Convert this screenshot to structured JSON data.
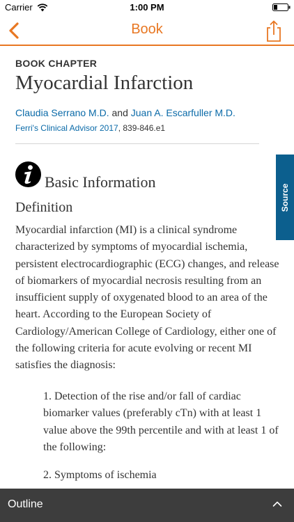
{
  "status_bar": {
    "carrier": "Carrier",
    "time": "1:00 PM",
    "icons": [
      "wifi-icon",
      "battery-icon"
    ]
  },
  "nav": {
    "title": "Book",
    "back_icon": "chevron-left-icon",
    "share_icon": "share-icon",
    "accent_color": "#e87722"
  },
  "chapter": {
    "label": "BOOK CHAPTER",
    "title": "Myocardial Infarction",
    "author_1": "Claudia Serrano M.D.",
    "author_joiner": " and ",
    "author_2": "Juan A. Escarfuller M.D.",
    "source_title": "Ferri's Clinical Advisor 2017",
    "source_pages": ", 839-846.e1",
    "link_color": "#0a6aa8"
  },
  "section": {
    "icon": "info-icon",
    "heading": "Basic Information",
    "subheading": "Definition",
    "paragraph": "Myocardial infarction (MI) is a clinical syndrome characterized by symptoms of myocardial ischemia, persistent electrocardiographic (ECG) changes, and release of biomarkers of myocardial necrosis resulting from an insufficient supply of oxygenated blood to an area of the heart. According to the European Society of Cardiology/American College of Cardiology, either one of the following criteria for acute evolving or recent MI satisfies the diagnosis:",
    "list_items": [
      "1. Detection of the rise and/or fall of cardiac biomarker values (preferably cTn) with at least 1 value above the 99th percentile and with at least 1 of the following:",
      "2. Symptoms of ischemia"
    ]
  },
  "source_tab": {
    "label": "Source",
    "color": "#0c5f8e"
  },
  "outline_bar": {
    "label": "Outline",
    "icon": "chevron-up-icon",
    "color": "#3d3d3d"
  }
}
